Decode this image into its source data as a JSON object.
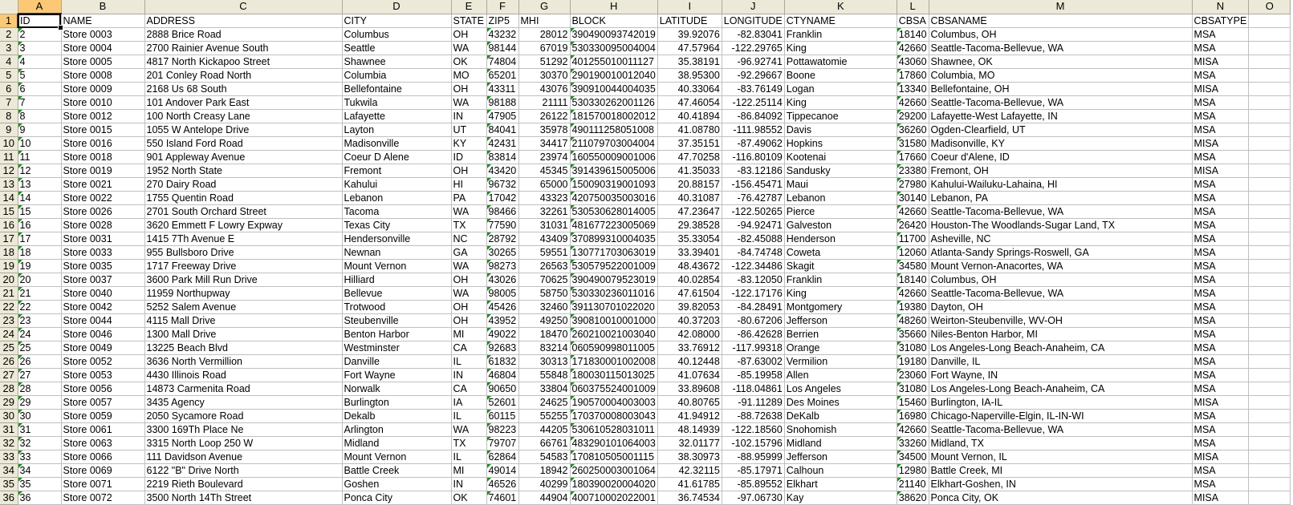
{
  "spreadsheet": {
    "active_cell": "A1",
    "column_letters": [
      "A",
      "B",
      "C",
      "D",
      "E",
      "F",
      "G",
      "H",
      "I",
      "J",
      "K",
      "L",
      "M",
      "N",
      "O"
    ],
    "headers": [
      "ID",
      "NAME",
      "ADDRESS",
      "CITY",
      "STATE",
      "ZIP5",
      "MHI",
      "BLOCK",
      "LATITUDE",
      "LONGITUDE",
      "CTYNAME",
      "CBSA",
      "CBSANAME",
      "CBSATYPE",
      ""
    ],
    "rows": [
      [
        "2",
        "Store 0003",
        "2888 Brice Road",
        "Columbus",
        "OH",
        "43232",
        "28012",
        "390490093742019",
        "39.92076",
        "-82.83041",
        "Franklin",
        "18140",
        "Columbus, OH",
        "MSA"
      ],
      [
        "3",
        "Store 0004",
        "2700 Rainier Avenue South",
        "Seattle",
        "WA",
        "98144",
        "67019",
        "530330095004004",
        "47.57964",
        "-122.29765",
        "King",
        "42660",
        "Seattle-Tacoma-Bellevue, WA",
        "MSA"
      ],
      [
        "4",
        "Store 0005",
        "4817 North Kickapoo Street",
        "Shawnee",
        "OK",
        "74804",
        "51292",
        "401255010011127",
        "35.38191",
        "-96.92741",
        "Pottawatomie",
        "43060",
        "Shawnee, OK",
        "MISA"
      ],
      [
        "5",
        "Store 0008",
        "201 Conley Road North",
        "Columbia",
        "MO",
        "65201",
        "30370",
        "290190010012040",
        "38.95300",
        "-92.29667",
        "Boone",
        "17860",
        "Columbia, MO",
        "MSA"
      ],
      [
        "6",
        "Store 0009",
        "2168 Us 68 South",
        "Bellefontaine",
        "OH",
        "43311",
        "43076",
        "390910044004035",
        "40.33064",
        "-83.76149",
        "Logan",
        "13340",
        "Bellefontaine, OH",
        "MISA"
      ],
      [
        "7",
        "Store 0010",
        "101 Andover Park East",
        "Tukwila",
        "WA",
        "98188",
        "21111",
        "530330262001126",
        "47.46054",
        "-122.25114",
        "King",
        "42660",
        "Seattle-Tacoma-Bellevue, WA",
        "MSA"
      ],
      [
        "8",
        "Store 0012",
        "100 North Creasy Lane",
        "Lafayette",
        "IN",
        "47905",
        "26122",
        "181570018002012",
        "40.41894",
        "-86.84092",
        "Tippecanoe",
        "29200",
        "Lafayette-West Lafayette, IN",
        "MSA"
      ],
      [
        "9",
        "Store 0015",
        "1055 W Antelope Drive",
        "Layton",
        "UT",
        "84041",
        "35978",
        "490111258051008",
        "41.08780",
        "-111.98552",
        "Davis",
        "36260",
        "Ogden-Clearfield, UT",
        "MSA"
      ],
      [
        "10",
        "Store 0016",
        "550 Island Ford Road",
        "Madisonville",
        "KY",
        "42431",
        "34417",
        "211079703004004",
        "37.35151",
        "-87.49062",
        "Hopkins",
        "31580",
        "Madisonville, KY",
        "MISA"
      ],
      [
        "11",
        "Store 0018",
        "901 Appleway Avenue",
        "Coeur D Alene",
        "ID",
        "83814",
        "23974",
        "160550009001006",
        "47.70258",
        "-116.80109",
        "Kootenai",
        "17660",
        "Coeur d'Alene, ID",
        "MSA"
      ],
      [
        "12",
        "Store 0019",
        "1952 North State",
        "Fremont",
        "OH",
        "43420",
        "45345",
        "391439615005006",
        "41.35033",
        "-83.12186",
        "Sandusky",
        "23380",
        "Fremont, OH",
        "MISA"
      ],
      [
        "13",
        "Store 0021",
        "270 Dairy Road",
        "Kahului",
        "HI",
        "96732",
        "65000",
        "150090319001093",
        "20.88157",
        "-156.45471",
        "Maui",
        "27980",
        "Kahului-Wailuku-Lahaina, HI",
        "MSA"
      ],
      [
        "14",
        "Store 0022",
        "1755 Quentin Road",
        "Lebanon",
        "PA",
        "17042",
        "43323",
        "420750035003016",
        "40.31087",
        "-76.42787",
        "Lebanon",
        "30140",
        "Lebanon, PA",
        "MSA"
      ],
      [
        "15",
        "Store 0026",
        "2701 South Orchard Street",
        "Tacoma",
        "WA",
        "98466",
        "32261",
        "530530628014005",
        "47.23647",
        "-122.50265",
        "Pierce",
        "42660",
        "Seattle-Tacoma-Bellevue, WA",
        "MSA"
      ],
      [
        "16",
        "Store 0028",
        "3620 Emmett F Lowry Expway",
        "Texas City",
        "TX",
        "77590",
        "31031",
        "481677223005069",
        "29.38528",
        "-94.92471",
        "Galveston",
        "26420",
        "Houston-The Woodlands-Sugar Land, TX",
        "MSA"
      ],
      [
        "17",
        "Store 0031",
        "1415 7Th Avenue E",
        "Hendersonville",
        "NC",
        "28792",
        "43409",
        "370899310004035",
        "35.33054",
        "-82.45088",
        "Henderson",
        "11700",
        "Asheville, NC",
        "MSA"
      ],
      [
        "18",
        "Store 0033",
        "955 Bullsboro Drive",
        "Newnan",
        "GA",
        "30265",
        "59551",
        "130771703063019",
        "33.39401",
        "-84.74748",
        "Coweta",
        "12060",
        "Atlanta-Sandy Springs-Roswell, GA",
        "MSA"
      ],
      [
        "19",
        "Store 0035",
        "1717 Freeway Drive",
        "Mount Vernon",
        "WA",
        "98273",
        "26563",
        "530579522001009",
        "48.43672",
        "-122.34486",
        "Skagit",
        "34580",
        "Mount Vernon-Anacortes, WA",
        "MSA"
      ],
      [
        "20",
        "Store 0037",
        "3600 Park Mill Run Drive",
        "Hilliard",
        "OH",
        "43026",
        "70625",
        "390490079523019",
        "40.02854",
        "-83.12050",
        "Franklin",
        "18140",
        "Columbus, OH",
        "MSA"
      ],
      [
        "21",
        "Store 0040",
        "11959 Northupway",
        "Bellevue",
        "WA",
        "98005",
        "58750",
        "530330236011016",
        "47.61504",
        "-122.17176",
        "King",
        "42660",
        "Seattle-Tacoma-Bellevue, WA",
        "MSA"
      ],
      [
        "22",
        "Store 0042",
        "5252 Salem Avenue",
        "Trotwood",
        "OH",
        "45426",
        "32460",
        "391130701022020",
        "39.82053",
        "-84.28491",
        "Montgomery",
        "19380",
        "Dayton, OH",
        "MSA"
      ],
      [
        "23",
        "Store 0044",
        "4115 Mall Drive",
        "Steubenville",
        "OH",
        "43952",
        "49250",
        "390810010001000",
        "40.37203",
        "-80.67206",
        "Jefferson",
        "48260",
        "Weirton-Steubenville, WV-OH",
        "MSA"
      ],
      [
        "24",
        "Store 0046",
        "1300 Mall Drive",
        "Benton Harbor",
        "MI",
        "49022",
        "18470",
        "260210021003040",
        "42.08000",
        "-86.42628",
        "Berrien",
        "35660",
        "Niles-Benton Harbor, MI",
        "MSA"
      ],
      [
        "25",
        "Store 0049",
        "13225 Beach Blvd",
        "Westminster",
        "CA",
        "92683",
        "83214",
        "060590998011005",
        "33.76912",
        "-117.99318",
        "Orange",
        "31080",
        "Los Angeles-Long Beach-Anaheim, CA",
        "MSA"
      ],
      [
        "26",
        "Store 0052",
        "3636 North Vermillion",
        "Danville",
        "IL",
        "61832",
        "30313",
        "171830001002008",
        "40.12448",
        "-87.63002",
        "Vermilion",
        "19180",
        "Danville, IL",
        "MSA"
      ],
      [
        "27",
        "Store 0053",
        "4430 Illinois Road",
        "Fort Wayne",
        "IN",
        "46804",
        "55848",
        "180030115013025",
        "41.07634",
        "-85.19958",
        "Allen",
        "23060",
        "Fort Wayne, IN",
        "MSA"
      ],
      [
        "28",
        "Store 0056",
        "14873 Carmenita Road",
        "Norwalk",
        "CA",
        "90650",
        "33804",
        "060375524001009",
        "33.89608",
        "-118.04861",
        "Los Angeles",
        "31080",
        "Los Angeles-Long Beach-Anaheim, CA",
        "MSA"
      ],
      [
        "29",
        "Store 0057",
        "3435 Agency",
        "Burlington",
        "IA",
        "52601",
        "24625",
        "190570004003003",
        "40.80765",
        "-91.11289",
        "Des Moines",
        "15460",
        "Burlington, IA-IL",
        "MISA"
      ],
      [
        "30",
        "Store 0059",
        "2050 Sycamore Road",
        "Dekalb",
        "IL",
        "60115",
        "55255",
        "170370008003043",
        "41.94912",
        "-88.72638",
        "DeKalb",
        "16980",
        "Chicago-Naperville-Elgin, IL-IN-WI",
        "MSA"
      ],
      [
        "31",
        "Store 0061",
        "3300 169Th Place Ne",
        "Arlington",
        "WA",
        "98223",
        "44205",
        "530610528031011",
        "48.14939",
        "-122.18560",
        "Snohomish",
        "42660",
        "Seattle-Tacoma-Bellevue, WA",
        "MSA"
      ],
      [
        "32",
        "Store 0063",
        "3315 North Loop 250 W",
        "Midland",
        "TX",
        "79707",
        "66761",
        "483290101064003",
        "32.01177",
        "-102.15796",
        "Midland",
        "33260",
        "Midland, TX",
        "MSA"
      ],
      [
        "33",
        "Store 0066",
        "111 Davidson Avenue",
        "Mount Vernon",
        "IL",
        "62864",
        "54583",
        "170810505001115",
        "38.30973",
        "-88.95999",
        "Jefferson",
        "34500",
        "Mount Vernon, IL",
        "MISA"
      ],
      [
        "34",
        "Store 0069",
        "6122 \"B\" Drive North",
        "Battle Creek",
        "MI",
        "49014",
        "18942",
        "260250003001064",
        "42.32115",
        "-85.17971",
        "Calhoun",
        "12980",
        "Battle Creek, MI",
        "MSA"
      ],
      [
        "35",
        "Store 0071",
        "2219 Rieth Boulevard",
        "Goshen",
        "IN",
        "46526",
        "40299",
        "180390020004020",
        "41.61785",
        "-85.89552",
        "Elkhart",
        "21140",
        "Elkhart-Goshen, IN",
        "MSA"
      ],
      [
        "36",
        "Store 0072",
        "3500 North 14Th Street",
        "Ponca City",
        "OK",
        "74601",
        "44904",
        "400710002022001",
        "36.74534",
        "-97.06730",
        "Kay",
        "38620",
        "Ponca City, OK",
        "MISA"
      ]
    ]
  },
  "colors": {
    "header_bg": "#ece9d8",
    "selected_header_bg": "#fbc875",
    "gridline": "#c0c0c0",
    "text_number_indicator": "#1a8f1a"
  }
}
